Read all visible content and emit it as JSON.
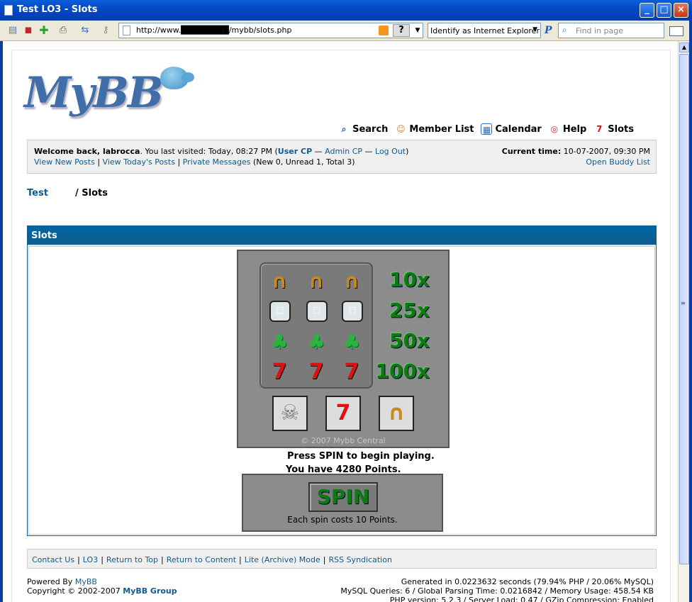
{
  "window": {
    "title": "Test LO3 - Slots",
    "min": "_",
    "max": "□",
    "close": "×"
  },
  "toolbar": {
    "url": "http://www.████████/mybb/slots.php",
    "help": "?",
    "identify": "Identify as Internet Explorer",
    "find_placeholder": "Find in page"
  },
  "nav": {
    "search": "Search",
    "member_list": "Member List",
    "calendar": "Calendar",
    "help": "Help",
    "slots": "Slots"
  },
  "welcome": {
    "prefix": "Welcome back, labrocca",
    "last_visit": ". You last visited: Today, 08:27 PM (",
    "user_cp": "User CP",
    "dash1": " — ",
    "admin_cp": "Admin CP",
    "dash2": " — ",
    "logout": "Log Out",
    "close_paren": ")",
    "view_new": "View New Posts",
    "view_today": "View Today's Posts",
    "pm": "Private Messages",
    "pm_counts": "(New 0, Unread 1, Total 3)",
    "current_time_label": "Current time:",
    "current_time": "10-07-2007, 09:30 PM",
    "buddy": "Open Buddy List"
  },
  "breadcrumb": {
    "forum": "Test",
    "current": "/ Slots"
  },
  "slots": {
    "header": "Slots",
    "rows": [
      {
        "symbol": "horseshoe-icon",
        "multiplier": "10x"
      },
      {
        "symbol": "dice-icon",
        "multiplier": "25x"
      },
      {
        "symbol": "clover-icon",
        "multiplier": "50x"
      },
      {
        "symbol": "seven-icon",
        "multiplier": "100x"
      }
    ],
    "copyright": "© 2007 Mybb Central",
    "message1": "Press SPIN to begin playing.",
    "message2": "You have 4280 Points.",
    "spin": "SPIN",
    "cost": "Each spin costs 10 Points."
  },
  "footer": {
    "links": [
      "Contact Us",
      "LO3",
      "Return to Top",
      "Return to Content",
      "Lite (Archive) Mode",
      "RSS Syndication"
    ],
    "powered_by": "Powered By",
    "mybb": "MyBB",
    "copyright": "Copyright © 2002-2007",
    "group": "MyBB Group",
    "generated": "Generated in 0.0223632 seconds (79.94% PHP / 20.06% MySQL)",
    "queries": "MySQL Queries: 6 / Global Parsing Time: 0.0216842 / Memory Usage: 458.54 KB",
    "php": "PHP version: 5.2.3 / Server Load: 0.47 / GZip Compression: Enabled"
  },
  "colors": {
    "link": "#0f5c8e",
    "header": "#0066a2",
    "machine": "#8c8c8c",
    "multiplier": "#0d7a14"
  }
}
